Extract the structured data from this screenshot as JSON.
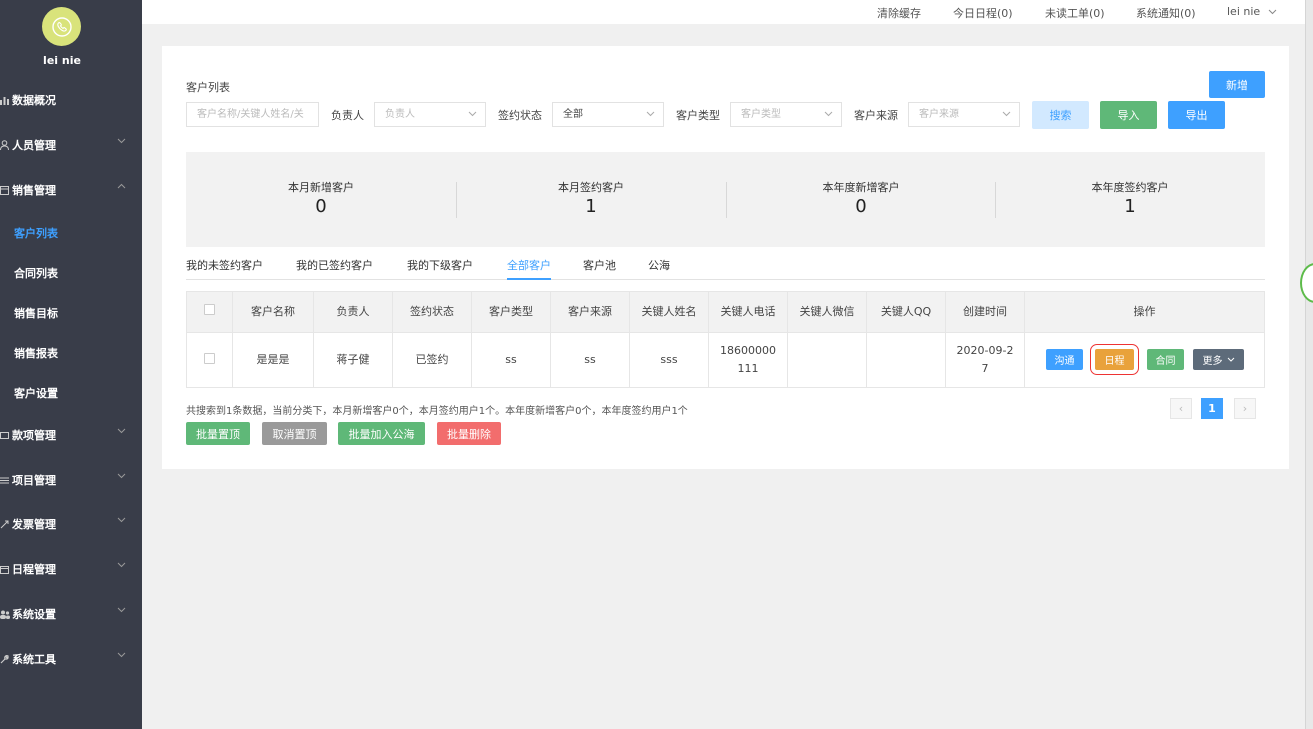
{
  "sidebar": {
    "username": "lei nie",
    "items": [
      {
        "label": "数据概况",
        "icon": "dashboard-icon"
      },
      {
        "label": "人员管理",
        "icon": "user-icon"
      },
      {
        "label": "销售管理",
        "icon": "sales-icon"
      },
      {
        "label": "款项管理",
        "icon": "money-icon"
      },
      {
        "label": "项目管理",
        "icon": "project-icon"
      },
      {
        "label": "发票管理",
        "icon": "invoice-icon"
      },
      {
        "label": "日程管理",
        "icon": "calendar-icon"
      },
      {
        "label": "系统设置",
        "icon": "users-icon"
      },
      {
        "label": "系统工具",
        "icon": "wrench-icon"
      }
    ],
    "sub_items": [
      {
        "label": "客户列表",
        "active": true
      },
      {
        "label": "合同列表"
      },
      {
        "label": "销售目标"
      },
      {
        "label": "销售报表"
      },
      {
        "label": "客户设置"
      }
    ]
  },
  "topbar": {
    "clear_cache": "清除缓存",
    "today_schedule": "今日日程(0)",
    "unread_orders": "未读工单(0)",
    "notifications": "系统通知(0)",
    "user_menu": "lei nie"
  },
  "page": {
    "title": "客户列表",
    "add_button": "新增"
  },
  "filters": {
    "name_placeholder": "客户名称/关键人姓名/关",
    "owner_label": "负责人",
    "owner_placeholder": "负责人",
    "sign_status_label": "签约状态",
    "sign_status_value": "全部",
    "customer_type_label": "客户类型",
    "customer_type_placeholder": "客户类型",
    "customer_source_label": "客户来源",
    "customer_source_placeholder": "客户来源",
    "search_button": "搜索",
    "import_button": "导入",
    "export_button": "导出"
  },
  "stats": [
    {
      "label": "本月新增客户",
      "value": "0"
    },
    {
      "label": "本月签约客户",
      "value": "1"
    },
    {
      "label": "本年度新增客户",
      "value": "0"
    },
    {
      "label": "本年度签约客户",
      "value": "1"
    }
  ],
  "tabs": [
    {
      "label": "我的未签约客户"
    },
    {
      "label": "我的已签约客户"
    },
    {
      "label": "我的下级客户"
    },
    {
      "label": "全部客户",
      "active": true
    },
    {
      "label": "客户池"
    },
    {
      "label": "公海"
    }
  ],
  "table": {
    "headers": [
      "客户名称",
      "负责人",
      "签约状态",
      "客户类型",
      "客户来源",
      "关键人姓名",
      "关键人电话",
      "关键人微信",
      "关键人QQ",
      "创建时间",
      "操作"
    ],
    "rows": [
      {
        "name": "是是是",
        "owner": "蒋子健",
        "status": "已签约",
        "type": "ss",
        "source": "ss",
        "contact_name": "sss",
        "contact_phone": "18600000111",
        "contact_wechat": "",
        "contact_qq": "",
        "created": "2020-09-27",
        "actions": {
          "communicate": "沟通",
          "schedule": "日程",
          "contract": "合同",
          "more": "更多"
        }
      }
    ]
  },
  "summary": "共搜索到1条数据，当前分类下，本月新增客户0个，本月签约用户1个。本年度新增客户0个，本年度签约用户1个",
  "bulk_actions": {
    "pin": "批量置顶",
    "unpin": "取消置顶",
    "to_public": "批量加入公海",
    "delete": "批量删除"
  },
  "pagination": {
    "prev": "‹",
    "current": "1",
    "next": "›"
  },
  "colors": {
    "sidebar_bg": "#393d49",
    "accent_blue": "#3ea0ff",
    "green": "#5fb878",
    "orange": "#e9a23b",
    "red": "#f26d6d",
    "grey": "#9a9a9a",
    "dark_grey": "#5d6b7a"
  }
}
